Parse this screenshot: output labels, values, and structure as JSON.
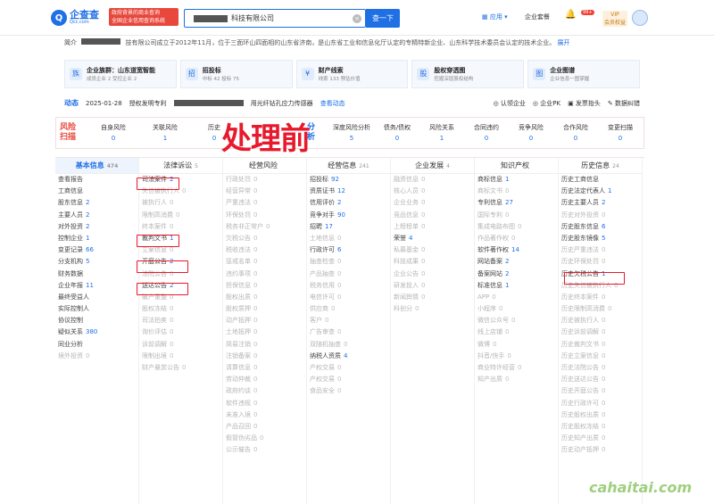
{
  "header": {
    "logo_text": "企查查",
    "logo_sub": "Qcc.com",
    "slogan_line1": "政府背景的商业查询",
    "slogan_line2": "全国企业信用查询系统",
    "search_value": "科技有限公司",
    "search_button": "查一下",
    "app_label": "应用",
    "package_label": "企业套餐",
    "badge": "99+",
    "vip_label": "VIP",
    "vip_sub": "会员权益"
  },
  "intro": {
    "label": "简介",
    "text": "技有限公司成立于2012年11月，位于三面环山四面相的山东省济南，是山东省工业和信息化厅认定的专精特新企业、山东科学技术委员会认定的技术企业。",
    "more": "展开"
  },
  "cards": [
    {
      "title": "企业族群：山东道宽智能",
      "sub": "成员企业 2  受控企业 2",
      "icon": "族"
    },
    {
      "title": "招投标",
      "sub": "中标 42  投标 75",
      "icon": "招"
    },
    {
      "title": "财产线索",
      "sub": "线索 133  预估价值",
      "icon": "¥"
    },
    {
      "title": "股权穿透图",
      "sub": "挖掘深层股权结构",
      "icon": "股"
    },
    {
      "title": "企业图谱",
      "sub": "企业信息一图掌握",
      "icon": "图"
    }
  ],
  "dynamic": {
    "label": "动态",
    "date": "2025-01-28",
    "text1": "授权发明专利",
    "text2": "用光纤钻孔应力传感器",
    "more": "查看动态",
    "actions": [
      "认领企业",
      "企业PK",
      "发票抬头",
      "数据纠错"
    ]
  },
  "risk": {
    "head_line1": "风险",
    "head_line2": "扫描",
    "left": [
      {
        "label": "自身风险",
        "value": "0"
      },
      {
        "label": "关联风险",
        "value": "1"
      },
      {
        "label": "历史",
        "value": "0"
      }
    ],
    "analysis_line1": "分",
    "analysis_line2": "析",
    "right": [
      {
        "label": "深度风险分析",
        "value": "5"
      },
      {
        "label": "债务/债权",
        "value": "0"
      },
      {
        "label": "风险关系",
        "value": "1"
      },
      {
        "label": "合同违约",
        "value": "0"
      },
      {
        "label": "竞争风险",
        "value": "0"
      },
      {
        "label": "合作风险",
        "value": "0"
      },
      {
        "label": "变更扫描",
        "value": "0"
      }
    ]
  },
  "annotation": "处理前",
  "columns": [
    {
      "title": "基本信息",
      "count": "474",
      "items": [
        [
          "查看报告",
          ""
        ],
        [
          "工商信息",
          ""
        ],
        [
          "股东信息",
          "2"
        ],
        [
          "主要人员",
          "2"
        ],
        [
          "对外投资",
          "2"
        ],
        [
          "控制企业",
          "1"
        ],
        [
          "变更记录",
          "66"
        ],
        [
          "分支机构",
          "5"
        ],
        [
          "财务数据",
          ""
        ],
        [
          "企业年报",
          "11"
        ],
        [
          "最终受益人",
          ""
        ],
        [
          "实际控制人",
          ""
        ],
        [
          "协议控制",
          ""
        ],
        [
          "疑似关系",
          "380"
        ],
        [
          "同业分析",
          ""
        ],
        [
          "境外投资",
          "0"
        ]
      ]
    },
    {
      "title": "法律诉讼",
      "count": "5",
      "items": [
        [
          "司法案件",
          "2"
        ],
        [
          "失信被执行人",
          "0"
        ],
        [
          "被执行人",
          "0"
        ],
        [
          "限制高消费",
          "0"
        ],
        [
          "终本案件",
          "0"
        ],
        [
          "裁判文书",
          "1"
        ],
        [
          "立案信息",
          "0"
        ],
        [
          "开庭公告",
          "2"
        ],
        [
          "法院公告",
          "0"
        ],
        [
          "送达公告",
          "2"
        ],
        [
          "破产重整",
          "0"
        ],
        [
          "股权冻结",
          "0"
        ],
        [
          "司法拍卖",
          "0"
        ],
        [
          "询价评估",
          "0"
        ],
        [
          "诉前调解",
          "0"
        ],
        [
          "限制出境",
          "0"
        ],
        [
          "财产悬赏公告",
          "0"
        ]
      ]
    },
    {
      "title": "经营风险",
      "count": "",
      "items": [
        [
          "行政处罚",
          "0"
        ],
        [
          "经营异常",
          "0"
        ],
        [
          "严重违法",
          "0"
        ],
        [
          "环保处罚",
          "0"
        ],
        [
          "税务非正常户",
          "0"
        ],
        [
          "欠税公告",
          "0"
        ],
        [
          "税收违法",
          "0"
        ],
        [
          "惩戒名单",
          "0"
        ],
        [
          "违约事项",
          "0"
        ],
        [
          "担保信息",
          "0"
        ],
        [
          "股权出质",
          "0"
        ],
        [
          "股权质押",
          "0"
        ],
        [
          "动产抵押",
          "0"
        ],
        [
          "土地抵押",
          "0"
        ],
        [
          "简易注销",
          "0"
        ],
        [
          "注销备案",
          "0"
        ],
        [
          "清算信息",
          "0"
        ],
        [
          "劳动仲裁",
          "0"
        ],
        [
          "政府约谈",
          "0"
        ],
        [
          "软件违规",
          "0"
        ],
        [
          "未准入境",
          "0"
        ],
        [
          "产品召回",
          "0"
        ],
        [
          "假冒伪劣品",
          "0"
        ],
        [
          "公示催告",
          "0"
        ]
      ]
    },
    {
      "title": "经营信息",
      "count": "241",
      "items": [
        [
          "招投标",
          "92"
        ],
        [
          "资质证书",
          "12"
        ],
        [
          "信用评价",
          "2"
        ],
        [
          "竞争对手",
          "90"
        ],
        [
          "招聘",
          "17"
        ],
        [
          "土地信息",
          "0"
        ],
        [
          "行政许可",
          "6"
        ],
        [
          "抽查检查",
          "0"
        ],
        [
          "产品抽查",
          "0"
        ],
        [
          "税务信用",
          "0"
        ],
        [
          "电信许可",
          "0"
        ],
        [
          "供应商",
          "0"
        ],
        [
          "客户",
          "0"
        ],
        [
          "广告审查",
          "0"
        ],
        [
          "双随机抽查",
          "0"
        ],
        [
          "纳税人资质",
          "4"
        ],
        [
          "产权交易",
          "0"
        ],
        [
          "产权交易",
          "0"
        ],
        [
          "食品安全",
          "0"
        ]
      ]
    },
    {
      "title": "企业发展",
      "count": "4",
      "items": [
        [
          "融资信息",
          "0"
        ],
        [
          "核心人员",
          "0"
        ],
        [
          "企业业务",
          "0"
        ],
        [
          "竞品信息",
          "0"
        ],
        [
          "上榜榜单",
          "0"
        ],
        [
          "荣誉",
          "4"
        ],
        [
          "私募基金",
          "0"
        ],
        [
          "科技成果",
          "0"
        ],
        [
          "企业公告",
          "0"
        ],
        [
          "研发投入",
          "0"
        ],
        [
          "新闻舆情",
          "0"
        ],
        [
          "科创分",
          "0"
        ]
      ]
    },
    {
      "title": "知识产权",
      "count": "",
      "items": [
        [
          "商标信息",
          "1"
        ],
        [
          "商标文书",
          "0"
        ],
        [
          "专利信息",
          "27"
        ],
        [
          "国际专利",
          "0"
        ],
        [
          "集成电路布图",
          "0"
        ],
        [
          "作品著作权",
          "0"
        ],
        [
          "软件著作权",
          "14"
        ],
        [
          "网站备案",
          "2"
        ],
        [
          "备案网站",
          "2"
        ],
        [
          "标准信息",
          "1"
        ],
        [
          "APP",
          "0"
        ],
        [
          "小程序",
          "0"
        ],
        [
          "微信公众号",
          "0"
        ],
        [
          "线上店铺",
          "0"
        ],
        [
          "微博",
          "0"
        ],
        [
          "抖音/快手",
          "0"
        ],
        [
          "商业特许经营",
          "0"
        ],
        [
          "知产出质",
          "0"
        ]
      ]
    },
    {
      "title": "历史信息",
      "count": "24",
      "items": [
        [
          "历史工商信息",
          ""
        ],
        [
          "历史法定代表人",
          "1"
        ],
        [
          "历史主要人员",
          "2"
        ],
        [
          "历史对外投资",
          "0"
        ],
        [
          "历史股东信息",
          "6"
        ],
        [
          "历史股东镜像",
          "5"
        ],
        [
          "历史严重违法",
          "0"
        ],
        [
          "历史环保处罚",
          "0"
        ],
        [
          "历史欠税公告",
          "1"
        ],
        [
          "历史失信被执行人",
          "0"
        ],
        [
          "历史终本案件",
          "0"
        ],
        [
          "历史限制高消费",
          "0"
        ],
        [
          "历史被执行人",
          "0"
        ],
        [
          "历史诉前调解",
          "0"
        ],
        [
          "历史裁判文书",
          "0"
        ],
        [
          "历史立案信息",
          "0"
        ],
        [
          "历史法院公告",
          "0"
        ],
        [
          "历史送达公告",
          "0"
        ],
        [
          "历史开庭公告",
          "0"
        ],
        [
          "历史行政许可",
          "0"
        ],
        [
          "历史股权出质",
          "0"
        ],
        [
          "历史股权冻结",
          "0"
        ],
        [
          "历史知产出质",
          "0"
        ],
        [
          "历史动产抵押",
          "0"
        ]
      ]
    }
  ],
  "watermark": "cahaitai.com"
}
